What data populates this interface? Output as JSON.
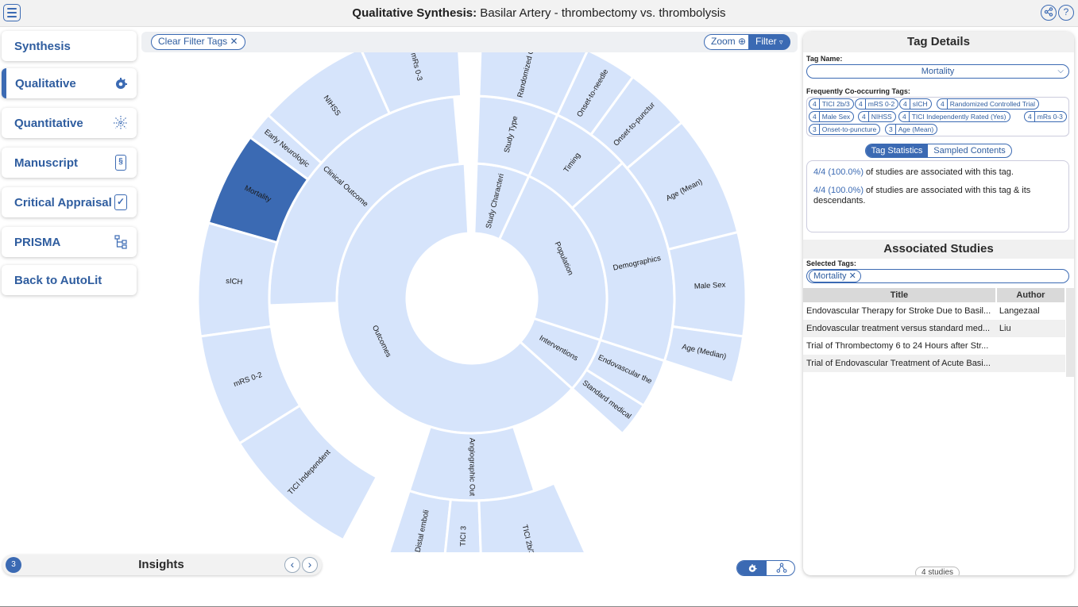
{
  "header": {
    "title_bold": "Qualitative Synthesis:",
    "title_rest": " Basilar Artery - thrombectomy vs. thrombolysis",
    "share_icon": "share-icon",
    "help_icon": "help-icon",
    "help_glyph": "?"
  },
  "nav": {
    "items": [
      {
        "label": "Synthesis",
        "icon": ""
      },
      {
        "label": "Qualitative",
        "icon": "sunburst-icon"
      },
      {
        "label": "Quantitative",
        "icon": "spark-icon"
      },
      {
        "label": "Manuscript",
        "icon": "document-icon"
      },
      {
        "label": "Critical Appraisal",
        "icon": "clipboard-check-icon"
      },
      {
        "label": "PRISMA",
        "icon": "flowchart-icon"
      },
      {
        "label": "Back to AutoLit",
        "icon": ""
      }
    ],
    "active": "Qualitative"
  },
  "toolbar": {
    "clear_filter": "Clear Filter Tags",
    "zoom": "Zoom",
    "filter": "Filter"
  },
  "sunburst": {
    "selected": "Mortality",
    "labels": {
      "outcomes": "Outcomes",
      "population": "Population",
      "study_char": "Study Characteri",
      "interventions": "Interventions",
      "clinical": "Clinical Outcome",
      "angio": "Angiographic Out",
      "study_type": "Study Type",
      "timing": "Timing",
      "demographics": "Demographics",
      "endovascular": "Endovascular the",
      "standard": "Standard medical",
      "mrs03": "mRs 0-3",
      "nihss": "NIHSS",
      "early": "Early Neurologic",
      "mortality": "Mortality",
      "sich": "sICH",
      "mrs02": "mRS 0-2",
      "tici_ind": "TICI Independent",
      "distal": "Distal emboli",
      "tici3": "TICI 3",
      "tici2b3": "TICI 2b/3",
      "rct": "Randomized Contr",
      "onset_needle": "Onset-to-needle",
      "onset_puncture": "Onset-to-punctur",
      "age_mean": "Age (Mean)",
      "male": "Male Sex",
      "age_median": "Age (Median)"
    }
  },
  "insights": {
    "count": "3",
    "title": "Insights",
    "prev": "‹",
    "next": "›"
  },
  "tag_details": {
    "heading": "Tag Details",
    "tag_name_label": "Tag Name:",
    "tag_name": "Mortality",
    "cooccur_label": "Frequently Co-occurring Tags:",
    "cooccur": [
      {
        "n": "4",
        "tag": "TICI 2b/3"
      },
      {
        "n": "4",
        "tag": "mRS 0-2"
      },
      {
        "n": "4",
        "tag": "sICH"
      },
      {
        "n": "4",
        "tag": "Randomized Controlled Trial"
      },
      {
        "n": "4",
        "tag": "Male Sex"
      },
      {
        "n": "4",
        "tag": "NIHSS"
      },
      {
        "n": "4",
        "tag": "TICI Independently Rated (Yes)"
      },
      {
        "n": "4",
        "tag": "mRs 0-3"
      },
      {
        "n": "3",
        "tag": "Onset-to-puncture"
      },
      {
        "n": "3",
        "tag": "Age (Mean)"
      }
    ],
    "tab_stats": "Tag Statistics",
    "tab_samples": "Sampled Contents",
    "stat1_value": "4/4 (100.0%)",
    "stat1_text": " of studies are associated with this tag.",
    "stat2_value": "4/4 (100.0%)",
    "stat2_text": " of studies are associated with this tag & its descendants."
  },
  "associated": {
    "heading": "Associated Studies",
    "selected_label": "Selected Tags:",
    "selected_tag": "Mortality",
    "col_title": "Title",
    "col_author": "Author",
    "rows": [
      {
        "title": "Endovascular Therapy for Stroke Due to Basil...",
        "author": "Langezaal"
      },
      {
        "title": "Endovascular treatment versus standard med...",
        "author": "Liu"
      },
      {
        "title": "Trial of Thrombectomy 6 to 24 Hours after Str...",
        "author": ""
      },
      {
        "title": "Trial of Endovascular Treatment of Acute Basi...",
        "author": ""
      }
    ],
    "count": "4 studies"
  },
  "colors": {
    "accent": "#3b6ab3",
    "segment": "#d6e4fb",
    "segment_selected": "#3b6ab3"
  }
}
